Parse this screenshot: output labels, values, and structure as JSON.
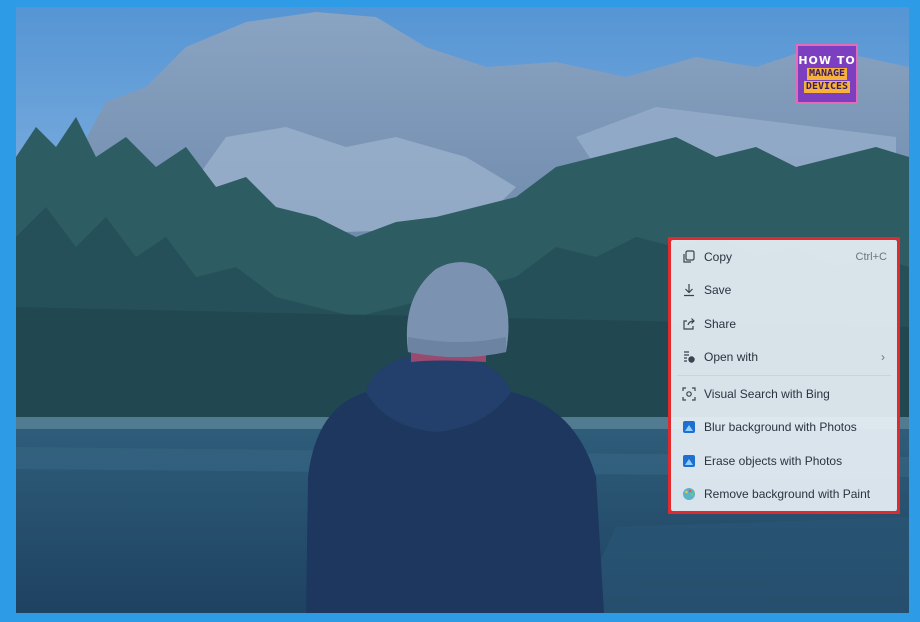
{
  "logo": {
    "line1": "HOW TO",
    "line2": "MANAGE",
    "line3": "DEVICES"
  },
  "context_menu": {
    "items_top": [
      {
        "id": "copy",
        "label": "Copy",
        "shortcut": "Ctrl+C",
        "icon": "copy-icon"
      },
      {
        "id": "save",
        "label": "Save",
        "icon": "download-icon"
      },
      {
        "id": "share",
        "label": "Share",
        "icon": "share-icon"
      },
      {
        "id": "open-with",
        "label": "Open with",
        "icon": "open-with-icon",
        "submenu": "›"
      }
    ],
    "items_bottom": [
      {
        "id": "visual-search",
        "label": "Visual Search with Bing",
        "icon": "visual-search-icon"
      },
      {
        "id": "blur-background",
        "label": "Blur background with Photos",
        "icon": "photos-icon"
      },
      {
        "id": "erase-objects",
        "label": "Erase objects with Photos",
        "icon": "photos-icon"
      },
      {
        "id": "remove-background",
        "label": "Remove background with Paint",
        "icon": "paint-icon"
      }
    ]
  },
  "colors": {
    "frame": "#2e9be6",
    "highlight_border": "#e12a2e",
    "menu_background": "#e8f0f6",
    "photos_icon": "#1f6fd1"
  }
}
